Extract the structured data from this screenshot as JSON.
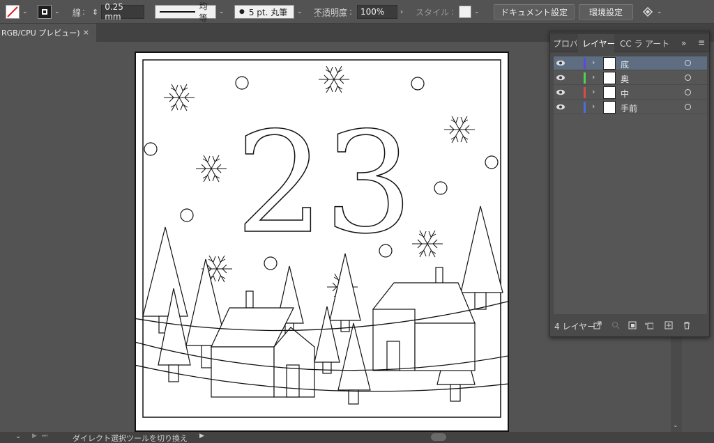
{
  "control_bar": {
    "stroke_label": "線",
    "stroke_weight": "0.25 mm",
    "profile_label": "均等",
    "brush_label": "5 pt. 丸筆",
    "opacity_label": "不透明度",
    "opacity_value": "100%",
    "style_label": "スタイル",
    "doc_settings_button": "ドキュメント設定",
    "preferences_button": "環境設定"
  },
  "document_tab": {
    "title": "RGB/CPU プレビュー)",
    "close": "×"
  },
  "layers_panel": {
    "tabs": [
      "プロパ",
      "レイヤー",
      "CC ラ",
      "アート"
    ],
    "layers": [
      {
        "name": "底",
        "color": "#5a4cd6",
        "selected": true
      },
      {
        "name": "奥",
        "color": "#4fd24f",
        "selected": false
      },
      {
        "name": "中",
        "color": "#d94a4a",
        "selected": false
      },
      {
        "name": "手前",
        "color": "#4a6fd9",
        "selected": false
      }
    ],
    "layer_count": "4 レイヤー"
  },
  "artwork": {
    "number": "23"
  },
  "status_bar": {
    "tool_hint": "ダイレクト選択ツールを切り換え"
  },
  "colors": {
    "ui_background": "#535353",
    "panel_background": "#4a4a4a",
    "selection": "#5e6d82"
  }
}
